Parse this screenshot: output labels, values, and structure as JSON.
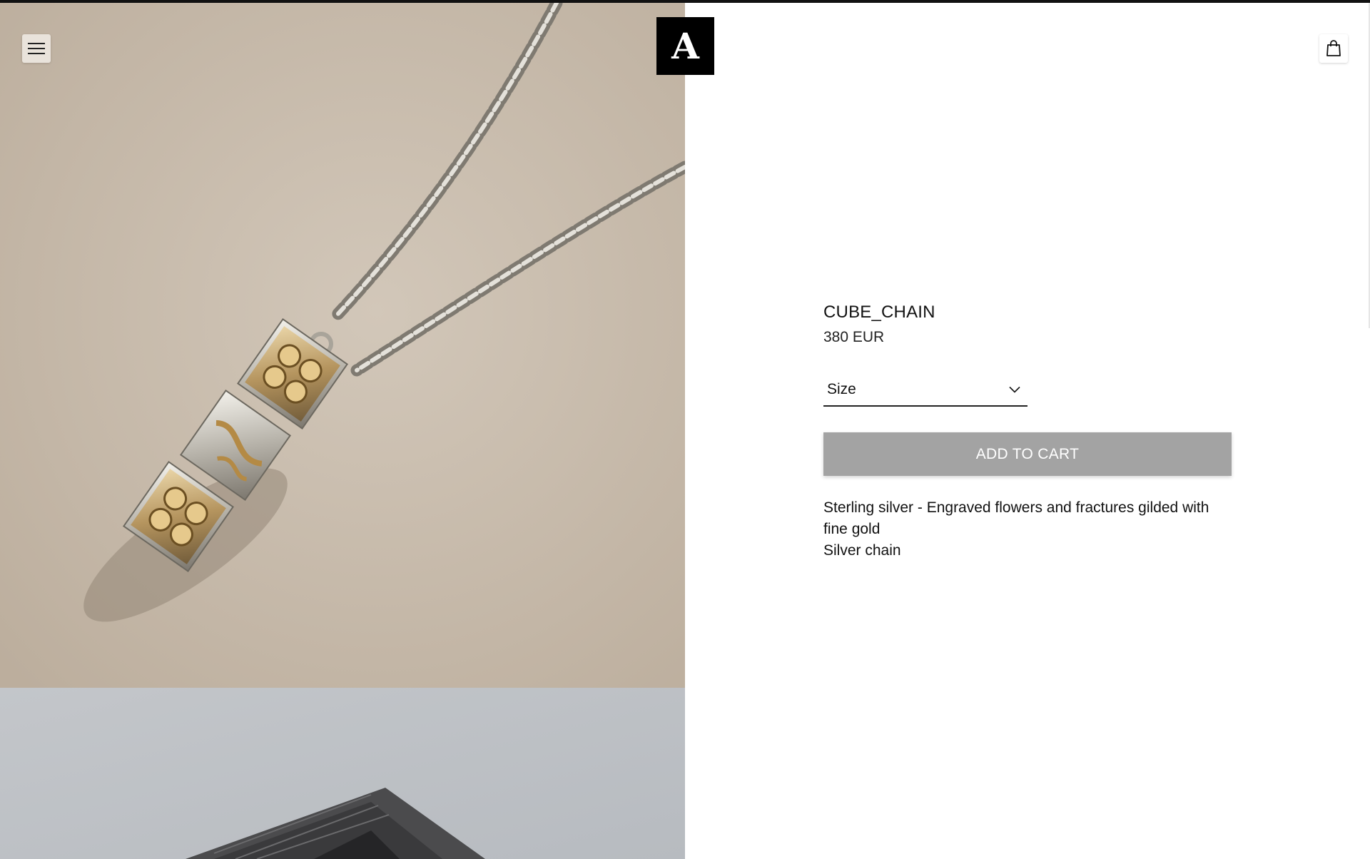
{
  "brand": {
    "logo_letter": "A"
  },
  "header": {
    "menu_icon": "hamburger-menu-icon",
    "cart_icon": "shopping-bag-icon"
  },
  "product": {
    "title": "CUBE_CHAIN",
    "price": "380 EUR",
    "size_select": {
      "label": "Size",
      "icon": "chevron-down-icon"
    },
    "add_to_cart_label": "ADD TO CART",
    "description": [
      "Sterling silver - Engraved flowers and fractures gilded with fine gold",
      "Silver chain"
    ]
  },
  "colors": {
    "button_disabled": "#a3a3a3",
    "photo_background_1": "#c9bdae",
    "photo_background_2": "#c4c7cb",
    "logo_background": "#000000"
  }
}
